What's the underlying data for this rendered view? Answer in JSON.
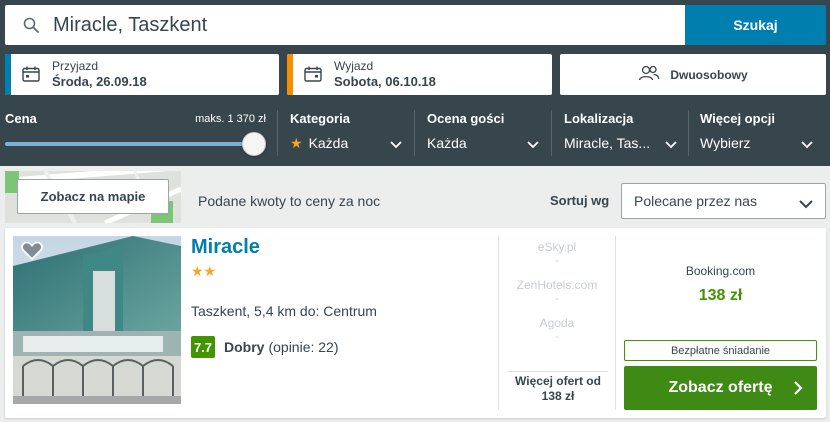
{
  "search": {
    "value": "Miracle, Taszkent",
    "button_label": "Szukaj"
  },
  "dates": {
    "checkin_label": "Przyjazd",
    "checkin_value": "Środa, 26.09.18",
    "checkout_label": "Wyjazd",
    "checkout_value": "Sobota, 06.10.18"
  },
  "room": {
    "label": "Dwuosobowy"
  },
  "filters": {
    "price": {
      "title": "Cena",
      "max_label": "maks. 1 370 zł",
      "slider_fraction": 1.0
    },
    "category": {
      "title": "Kategoria",
      "value": "Każda"
    },
    "rating": {
      "title": "Ocena gości",
      "value": "Każda"
    },
    "location": {
      "title": "Lokalizacja",
      "value": "Miracle, Tas..."
    },
    "more": {
      "title": "Więcej opcji",
      "value": "Wybierz"
    }
  },
  "toolbar": {
    "map_button": "Zobacz na mapie",
    "price_note": "Podane kwoty to ceny za noc",
    "sort_label": "Sortuj wg",
    "sort_value": "Polecane przez nas"
  },
  "hotel": {
    "name": "Miracle",
    "stars": "★★",
    "location": "Taszkent, 5,4 km do: Centrum",
    "rating_score": "7.7",
    "rating_text": "Dobry",
    "rating_count": "(opinie: 22)",
    "partners": [
      "eSky.pl",
      "ZenHotels.com",
      "Agoda"
    ],
    "partner_dash": "-",
    "more_offers": "Więcej ofert od",
    "more_offers_price": "138 zł",
    "best_site": "Booking.com",
    "best_price": "138 zł",
    "badge": "Bezpłatne śniadanie",
    "deal_button": "Zobacz ofertę"
  },
  "colors": {
    "header_bg": "#37454d",
    "accent_blue": "#007faf",
    "accent_orange": "#f48f00",
    "price_green": "#429400",
    "deal_green": "#3f8a15"
  }
}
